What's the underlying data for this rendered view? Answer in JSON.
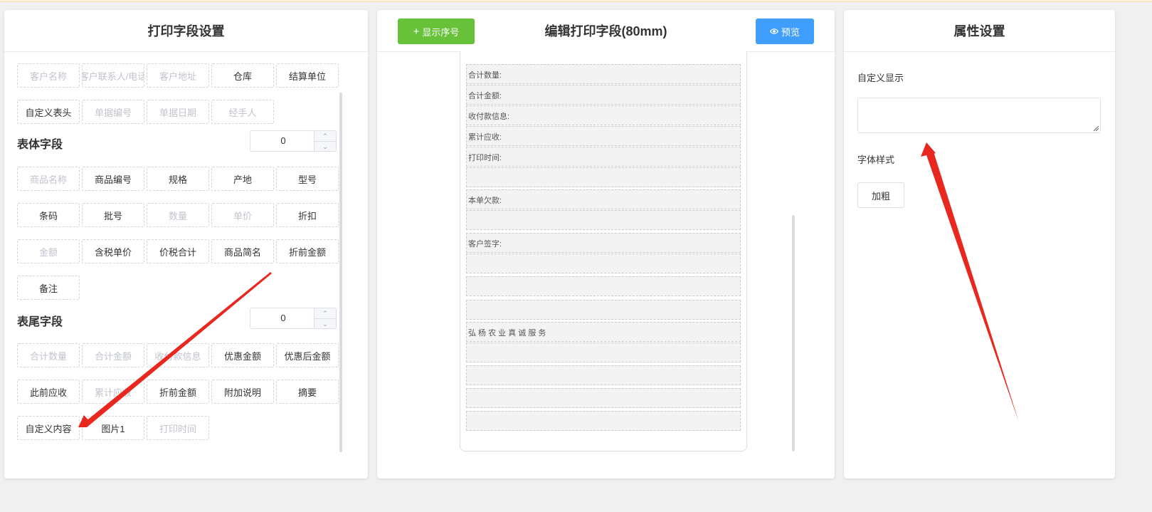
{
  "left_panel": {
    "title": "打印字段设置",
    "header_fields": [
      {
        "label": "客户名称",
        "active": false
      },
      {
        "label": "客户联系人/电话",
        "active": false
      },
      {
        "label": "客户地址",
        "active": false
      },
      {
        "label": "仓库",
        "active": true
      },
      {
        "label": "结算单位",
        "active": true
      },
      {
        "label": "自定义表头",
        "active": true
      },
      {
        "label": "单据编号",
        "active": false
      },
      {
        "label": "单据日期",
        "active": false
      },
      {
        "label": "经手人",
        "active": false
      }
    ],
    "body_section": {
      "title": "表体字段",
      "stepper_value": "0",
      "fields": [
        {
          "label": "商品名称",
          "active": false
        },
        {
          "label": "商品编号",
          "active": true
        },
        {
          "label": "规格",
          "active": true
        },
        {
          "label": "产地",
          "active": true
        },
        {
          "label": "型号",
          "active": true
        },
        {
          "label": "条码",
          "active": true
        },
        {
          "label": "批号",
          "active": true
        },
        {
          "label": "数量",
          "active": false
        },
        {
          "label": "单价",
          "active": false
        },
        {
          "label": "折扣",
          "active": true
        },
        {
          "label": "金额",
          "active": false
        },
        {
          "label": "含税单价",
          "active": true
        },
        {
          "label": "价税合计",
          "active": true
        },
        {
          "label": "商品简名",
          "active": true
        },
        {
          "label": "折前金额",
          "active": true
        },
        {
          "label": "备注",
          "active": true
        }
      ]
    },
    "footer_section": {
      "title": "表尾字段",
      "stepper_value": "0",
      "fields": [
        {
          "label": "合计数量",
          "active": false
        },
        {
          "label": "合计金额",
          "active": false
        },
        {
          "label": "收付款信息",
          "active": false
        },
        {
          "label": "优惠金额",
          "active": true
        },
        {
          "label": "优惠后金额",
          "active": true
        },
        {
          "label": "此前应收",
          "active": true
        },
        {
          "label": "累计应收",
          "active": false
        },
        {
          "label": "折前金额",
          "active": true
        },
        {
          "label": "附加说明",
          "active": true
        },
        {
          "label": "摘要",
          "active": true
        },
        {
          "label": "自定义内容",
          "active": true
        },
        {
          "label": "图片1",
          "active": true
        },
        {
          "label": "打印时间",
          "active": false
        }
      ]
    }
  },
  "middle_panel": {
    "title": "编辑打印字段(80mm)",
    "show_index_button": "显示序号",
    "preview_button": "预览",
    "paper_rows": [
      "合计数量:",
      "合计金额:",
      "收付款信息:",
      "累计应收:",
      "打印时间:",
      "",
      "本单欠款:",
      "",
      "客户签字:",
      "",
      "",
      "",
      "弘 杨 农 业 真 诚 服 务",
      "",
      "",
      "",
      ""
    ]
  },
  "right_panel": {
    "title": "属性设置",
    "custom_display_label": "自定义显示",
    "custom_display_value": "",
    "font_style_label": "字体样式",
    "bold_button": "加粗"
  },
  "colors": {
    "green": "#67c23a",
    "blue": "#409eff",
    "annotation_arrow": "#e8281e",
    "disabled_text": "#c0c4cc"
  }
}
